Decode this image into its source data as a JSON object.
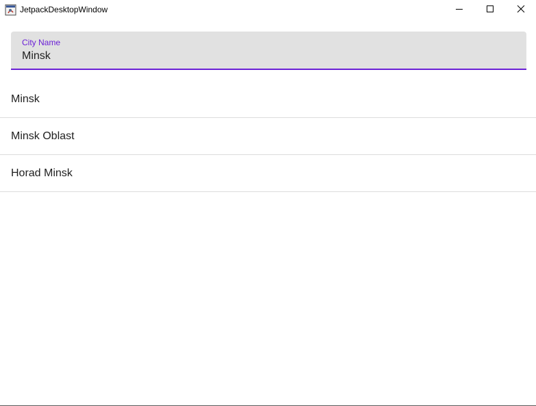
{
  "window": {
    "title": "JetpackDesktopWindow",
    "controls": {
      "minimize_icon": "minimize-icon",
      "maximize_icon": "maximize-icon",
      "close_icon": "close-icon"
    }
  },
  "search": {
    "label": "City Name",
    "value": "Minsk"
  },
  "results": [
    {
      "label": "Minsk"
    },
    {
      "label": "Minsk Oblast"
    },
    {
      "label": "Horad Minsk"
    }
  ],
  "colors": {
    "accent": "#6a1fd6",
    "field_background": "#e1e1e1",
    "divider": "#dcdcdc"
  }
}
